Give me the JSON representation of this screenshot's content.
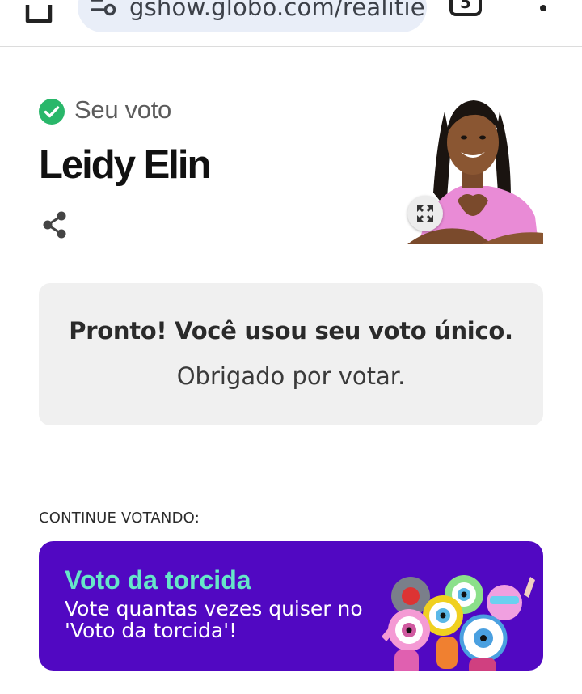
{
  "browser": {
    "url": "gshow.globo.com/realitie",
    "tab_count": "5"
  },
  "vote": {
    "label": "Seu voto",
    "candidate": "Leidy Elin"
  },
  "confirmation": {
    "title": "Pronto! Você usou seu voto único.",
    "subtitle": "Obrigado por votar."
  },
  "continue_section": {
    "label": "CONTINUE VOTANDO:",
    "card": {
      "title": "Voto da torcida",
      "text": "Vote quantas vezes quiser no 'Voto da torcida'!"
    }
  },
  "colors": {
    "check_green": "#29b76a",
    "promo_bg": "#5108c2",
    "promo_title": "#66e7c8"
  },
  "icons": [
    "home-icon",
    "site-settings-icon",
    "tabs-icon",
    "more-menu-icon",
    "check-circle-icon",
    "share-icon",
    "expand-icon"
  ]
}
